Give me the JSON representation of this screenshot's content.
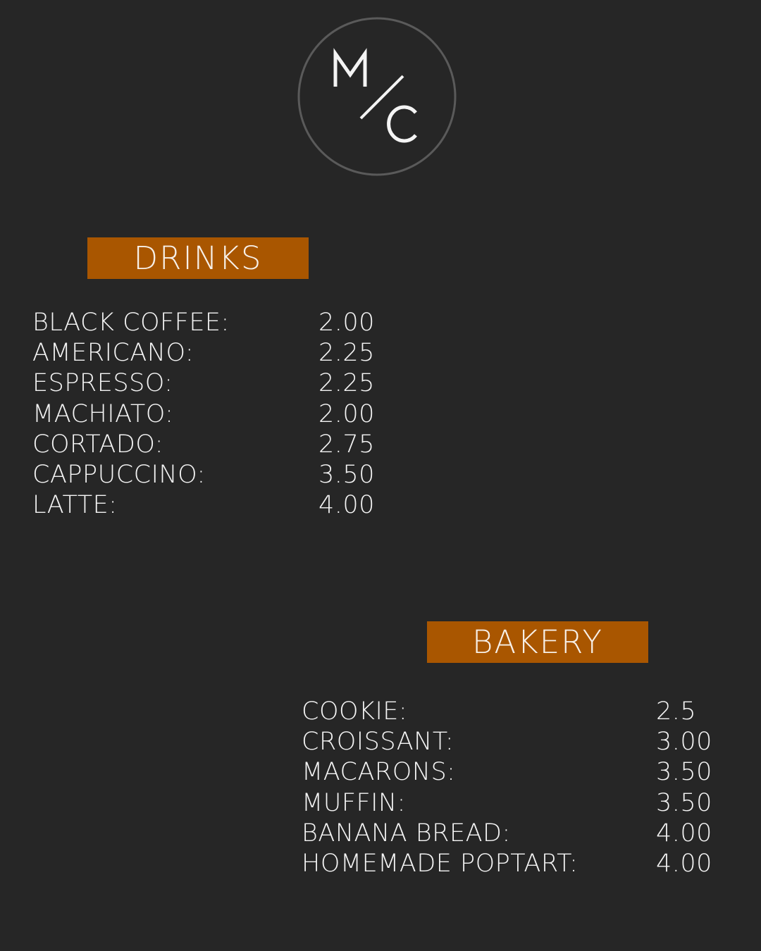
{
  "logo": {
    "text": "M/C",
    "ring_color": "#5a5a5a",
    "letter_color": "#f4f4f4"
  },
  "colors": {
    "background": "#262626",
    "accent": "#a95600",
    "text": "#f4f4f4"
  },
  "drinks": {
    "heading": "DRINKS",
    "items": [
      {
        "name": "BLACK COFFEE:",
        "price": "2.00"
      },
      {
        "name": "AMERICANO:",
        "price": "2.25"
      },
      {
        "name": "ESPRESSO:",
        "price": "2.25"
      },
      {
        "name": "MACHIATO:",
        "price": "2.00"
      },
      {
        "name": "CORTADO:",
        "price": "2.75"
      },
      {
        "name": "CAPPUCCINO:",
        "price": "3.50"
      },
      {
        "name": "LATTE:",
        "price": "4.00"
      }
    ]
  },
  "bakery": {
    "heading": "BAKERY",
    "items": [
      {
        "name": "COOKIE:",
        "price": "2.5"
      },
      {
        "name": "CROISSANT:",
        "price": "3.00"
      },
      {
        "name": "MACARONS:",
        "price": "3.50"
      },
      {
        "name": "MUFFIN:",
        "price": "3.50"
      },
      {
        "name": "BANANA BREAD:",
        "price": "4.00"
      },
      {
        "name": "HOMEMADE POPTART:",
        "price": "4.00"
      }
    ]
  }
}
